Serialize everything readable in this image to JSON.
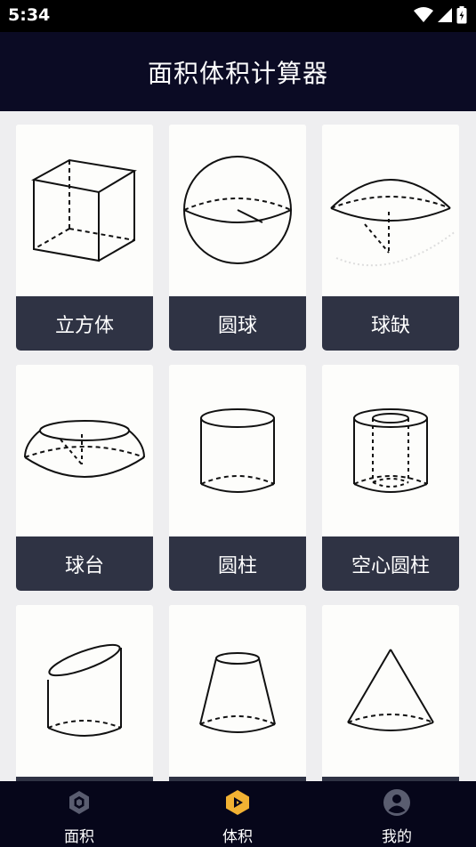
{
  "status": {
    "time": "5:34"
  },
  "header": {
    "title": "面积体积计算器"
  },
  "shapes": [
    {
      "id": "cube",
      "label": "立方体"
    },
    {
      "id": "sphere",
      "label": "圆球"
    },
    {
      "id": "spherical-cap",
      "label": "球缺"
    },
    {
      "id": "spherical-segment",
      "label": "球台"
    },
    {
      "id": "cylinder",
      "label": "圆柱"
    },
    {
      "id": "hollow-cylinder",
      "label": "空心圆柱"
    },
    {
      "id": "truncated-cylinder",
      "label": ""
    },
    {
      "id": "frustum",
      "label": ""
    },
    {
      "id": "cone",
      "label": ""
    }
  ],
  "nav": {
    "items": [
      {
        "label": "面积",
        "icon": "hexagon-icon",
        "active": false
      },
      {
        "label": "体积",
        "icon": "cube-play-icon",
        "active": true
      },
      {
        "label": "我的",
        "icon": "user-icon",
        "active": false
      }
    ],
    "active_color": "#f2b233",
    "inactive_color": "#5a5d70"
  }
}
